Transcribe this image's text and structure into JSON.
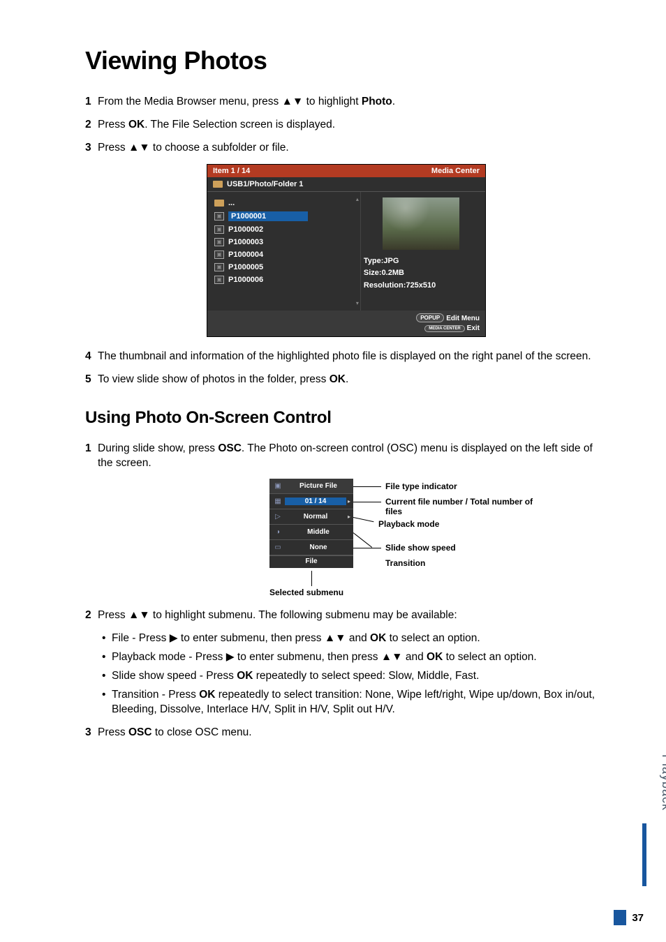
{
  "title": "Viewing Photos",
  "section2_title": "Using Photo On-Screen Control",
  "steps_a": [
    {
      "n": "1",
      "pre": "From the Media Browser menu, press ",
      "post": " to highlight ",
      "bold": "Photo",
      "end": "."
    },
    {
      "n": "2",
      "pre": "Press ",
      "bold": "OK",
      "post": ". The File Selection screen is displayed."
    },
    {
      "n": "3",
      "pre": "Press ",
      "post": " to choose a subfolder or file."
    }
  ],
  "steps_b": [
    {
      "n": "4",
      "text": "The thumbnail and information of the highlighted photo file is displayed on the right panel of the screen."
    },
    {
      "n": "5",
      "pre": "To view slide show of photos in the folder, press ",
      "bold": "OK",
      "end": "."
    }
  ],
  "steps_c": [
    {
      "n": "1",
      "pre": "During slide show, press ",
      "bold": "OSC",
      "post": ". The Photo on-screen control (OSC) menu is displayed on the left side of the screen."
    }
  ],
  "step_d_lead": {
    "n": "2",
    "pre": "Press ",
    "post": " to highlight submenu. The following submenu may be available:"
  },
  "bullets": [
    {
      "pre": "File - Press ",
      "mid": " to enter submenu, then press ",
      "post": " and ",
      "bold": "OK",
      "end": " to select an option."
    },
    {
      "pre": "Playback mode - Press ",
      "mid": " to enter submenu, then press ",
      "post": " and ",
      "bold": "OK",
      "end": " to select an option."
    },
    {
      "pre": "Slide show speed - Press ",
      "bold": "OK",
      "post": " repeatedly to select speed: Slow, Middle, Fast."
    },
    {
      "pre": "Transition - Press ",
      "bold": "OK",
      "post": " repeatedly to select transition: None, Wipe left/right, Wipe up/down, Box in/out, Bleeding, Dissolve, Interlace H/V, Split in H/V, Split out H/V."
    }
  ],
  "step_e": {
    "n": "3",
    "pre": "Press ",
    "bold": "OSC",
    "post": " to close OSC menu."
  },
  "shot1": {
    "hdr_left": "Item 1 / 14",
    "hdr_right": "Media Center",
    "path": "USB1/Photo/Folder 1",
    "up": "...",
    "files": [
      "P1000001",
      "P1000002",
      "P1000003",
      "P1000004",
      "P1000005",
      "P1000006"
    ],
    "type": "Type:JPG",
    "size": "Size:0.2MB",
    "res": "Resolution:725x510",
    "ftr_popup": "POPUP",
    "ftr_edit": "Edit Menu",
    "ftr_media": "MEDIA CENTER",
    "ftr_exit": "Exit"
  },
  "shot2": {
    "rows": [
      {
        "ico": "▣",
        "val": "Picture File"
      },
      {
        "ico": "▦",
        "val": "01 / 14"
      },
      {
        "ico": "▷",
        "val": "Normal"
      },
      {
        "ico": "◑",
        "val": "Middle"
      },
      {
        "ico": "▭",
        "val": "None"
      }
    ],
    "file": "File",
    "labels": {
      "type": "File type indicator",
      "num": "Current file number / Total number of files",
      "mode": "Playback mode",
      "speed": "Slide show speed",
      "trans": "Transition",
      "sel": "Selected submenu"
    }
  },
  "sidetab": "Playback",
  "pagenum": "37"
}
